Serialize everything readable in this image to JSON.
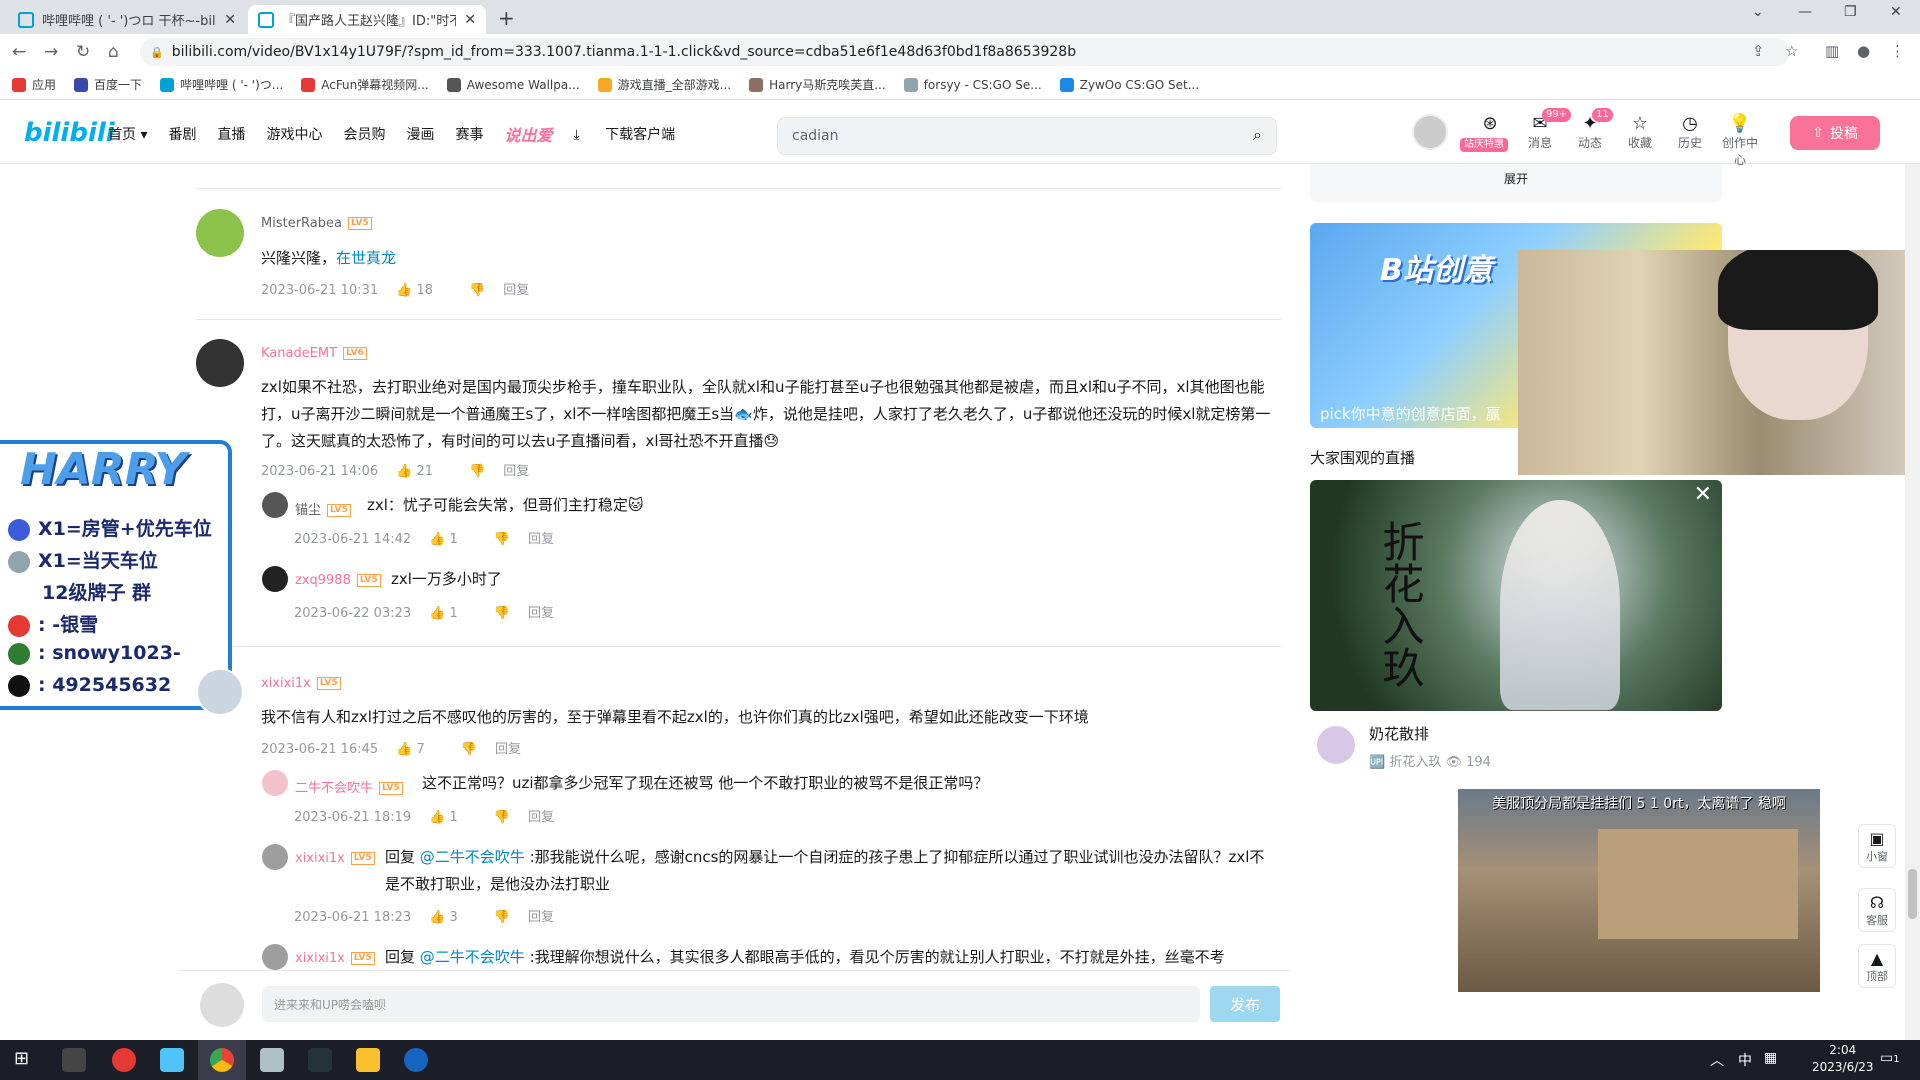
{
  "tabs": [
    {
      "title": "哔哩哔哩 ( '- ')つロ 干杯~-bili"
    },
    {
      "title": "『国产路人王赵兴隆』ID:\"时不"
    }
  ],
  "url": "bilibili.com/video/BV1x14y1U79F/?spm_id_from=333.1007.tianma.1-1-1.click&vd_source=cdba51e6f1e48d63f0bd1f8a8653928b",
  "bookmarks": [
    {
      "label": "应用",
      "color": "#e53935"
    },
    {
      "label": "百度一下",
      "color": "#3949ab"
    },
    {
      "label": "哔哩哔哩 ( '- ')つ...",
      "color": "#00a1d6"
    },
    {
      "label": "AcFun弹幕视频网...",
      "color": "#e53935"
    },
    {
      "label": "Awesome Wallpa...",
      "color": "#555555"
    },
    {
      "label": "游戏直播_全部游戏...",
      "color": "#f9a825"
    },
    {
      "label": "Harry马斯克唉芙直...",
      "color": "#8d6e63"
    },
    {
      "label": "forsyy - CS:GO Se...",
      "color": "#90a4ae"
    },
    {
      "label": "ZywOo CS:GO Set...",
      "color": "#1e88e5"
    }
  ],
  "header": {
    "logo": "bilibili",
    "nav": [
      "首页 ▾",
      "番剧",
      "直播",
      "游戏中心",
      "会员购",
      "漫画",
      "赛事",
      "说出爱",
      "下载客户端"
    ],
    "search_value": "cadian",
    "vip_tag": "站庆特惠",
    "items": [
      {
        "label": "消息",
        "icon": "✉",
        "badge": "99+"
      },
      {
        "label": "动态",
        "icon": "✦",
        "badge": "11"
      },
      {
        "label": "收藏",
        "icon": "☆",
        "badge": ""
      },
      {
        "label": "历史",
        "icon": "◷",
        "badge": ""
      },
      {
        "label": "创作中心",
        "icon": "💡",
        "badge": ""
      }
    ],
    "upload": "投稿"
  },
  "comments": [
    {
      "user": "MisterRabea",
      "level": "LV5",
      "text_plain": "兴隆兴隆，",
      "text_link": "在世真龙",
      "date": "2023-06-21 10:31",
      "likes": "18"
    },
    {
      "user": "KanadeEMT",
      "level": "LV6",
      "text": "zxl如果不社恐，去打职业绝对是国内最顶尖步枪手，撞车职业队，全队就xl和u子能打甚至u子也很勉强其他都是被虐，而且xl和u子不同，xl其他图也能打，u子离开沙二瞬间就是一个普通魔王s了，xl不一样啥图都把魔王s当🐟炸，说他是挂吧，人家打了老久老久了，u子都说他还没玩的时候xl就定榜第一了。这天赋真的太恐怖了，有时间的可以去u子直播间看，xl哥社恐不开直播😓",
      "date": "2023-06-21 14:06",
      "likes": "21"
    },
    {
      "user": "锚尘",
      "level": "LV5",
      "text": "zxl：忧子可能会失常，但哥们主打稳定🐱",
      "date": "2023-06-21 14:42",
      "likes": "1"
    },
    {
      "user": "zxq9988",
      "level": "LV5",
      "text": "zxl一万多小时了",
      "date": "2023-06-22 03:23",
      "likes": "1"
    },
    {
      "user": "xixixi1x",
      "level": "LV5",
      "text": "我不信有人和zxl打过之后不感叹他的厉害的，至于弹幕里看不起zxl的，也许你们真的比zxl强吧，希望如此还能改变一下环境",
      "date": "2023-06-21 16:45",
      "likes": "7"
    },
    {
      "user": "二牛不会吹牛",
      "level": "LV5",
      "text": "这不正常吗？uzi都拿多少冠军了现在还被骂  他一个不敢打职业的被骂不是很正常吗？",
      "date": "2023-06-21 18:19",
      "likes": "1"
    },
    {
      "user": "xixixi1x",
      "level": "LV5",
      "reply_prefix": "回复 ",
      "reply_to": "@二牛不会吹牛",
      "text": " :那我能说什么呢，感谢cncs的网暴让一个自闭症的孩子患上了抑郁症所以通过了职业试训也没办法留队？zxl不是不敢打职业，是他没办法打职业",
      "date": "2023-06-21 18:23",
      "likes": "3"
    },
    {
      "user": "xixixi1x",
      "level": "LV5",
      "reply_prefix": "回复 ",
      "reply_to": "@二牛不会吹牛",
      "text": " :我理解你想说什么，其实很多人都眼高手低的，看见个厉害的就让别人打职业，不打就是外挂，丝毫不考"
    }
  ],
  "reply_label": "回复",
  "reply_box": {
    "placeholder": "进来来和UP唠会嗑呗",
    "button": "发布"
  },
  "right": {
    "expand": "展开",
    "banner_title": "B站创意",
    "banner_sub": "pick你中意的创意店面，赢",
    "live_heading": "大家围观的直播",
    "live_calligraphy": "折花入玖",
    "streamer_name": "奶花散排",
    "streamer_room": "折花入玖",
    "streamer_viewers": "194",
    "mini_title": "美服顶分局都是挂挂们 5 1 0rt，太离谱了  稳啊"
  },
  "float_buttons": [
    {
      "label": "小窗",
      "icon": "▣"
    },
    {
      "label": "客服",
      "icon": "☊"
    },
    {
      "label": "顶部",
      "icon": "▲"
    }
  ],
  "overlay": {
    "title": "HARRY",
    "lines": [
      "X1=房管+优先车位",
      "X1=当天车位",
      "12级牌子 群",
      ": -银雪",
      ": snowy1023-",
      ": 492545632"
    ]
  },
  "taskbar": {
    "time": "2:04",
    "date": "2023/6/23",
    "ime": "中",
    "notif": "1"
  }
}
